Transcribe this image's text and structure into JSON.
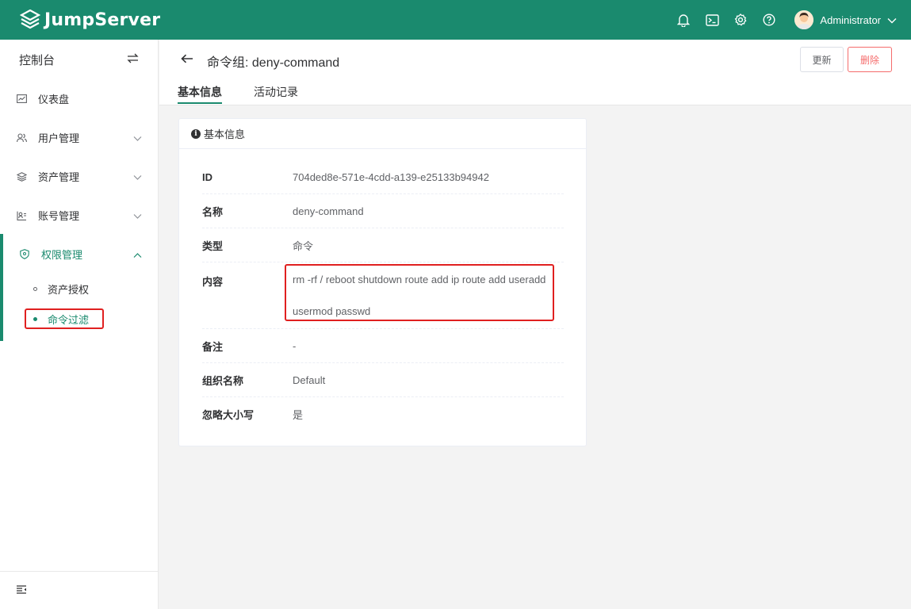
{
  "header": {
    "brand": "JumpServer",
    "user_name": "Administrator",
    "icons": [
      "bell-icon",
      "terminal-icon",
      "settings-icon",
      "help-icon"
    ]
  },
  "sidebar": {
    "title": "控制台",
    "items": [
      {
        "label": "仪表盘",
        "icon": "dashboard-icon"
      },
      {
        "label": "用户管理",
        "icon": "users-icon"
      },
      {
        "label": "资产管理",
        "icon": "layers-icon"
      },
      {
        "label": "账号管理",
        "icon": "accounts-icon"
      },
      {
        "label": "权限管理",
        "icon": "shield-icon"
      }
    ],
    "subitems": [
      {
        "label": "资产授权"
      },
      {
        "label": "命令过滤"
      }
    ]
  },
  "page": {
    "title": "命令组: deny-command",
    "update_label": "更新",
    "delete_label": "删除",
    "tabs": [
      {
        "label": "基本信息"
      },
      {
        "label": "活动记录"
      }
    ]
  },
  "card": {
    "title": "基本信息",
    "rows": [
      {
        "key": "ID",
        "value": "704ded8e-571e-4cdd-a139-e25133b94942"
      },
      {
        "key": "名称",
        "value": "deny-command"
      },
      {
        "key": "类型",
        "value": "命令"
      },
      {
        "key": "内容",
        "value_line1": "rm -rf / reboot shutdown route add ip route add useradd",
        "value_line2": "usermod passwd"
      },
      {
        "key": "备注",
        "value": "-"
      },
      {
        "key": "组织名称",
        "value": "Default"
      },
      {
        "key": "忽略大小写",
        "value": "是"
      }
    ]
  },
  "colors": {
    "brand": "#1a8a6e",
    "danger": "#f56c6c",
    "highlight": "#e02020"
  }
}
